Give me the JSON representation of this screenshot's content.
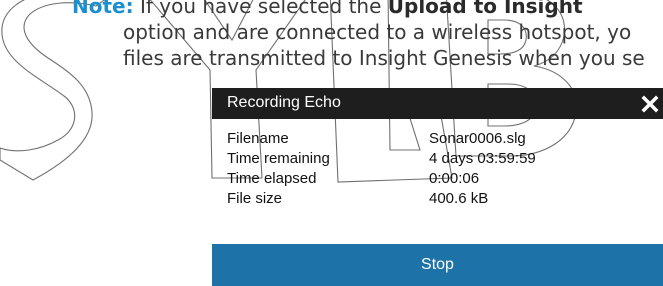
{
  "doc": {
    "note_label": "Note:",
    "line1_text": " If you have selected the ",
    "line1_bold": "Upload to Insight",
    "line2_text": "option and are connected to a wireless hotspot, yo",
    "line3_text": "files are transmitted to Insight Genesis when you se"
  },
  "dialog": {
    "title": "Recording Echo",
    "close_icon": "close-icon",
    "rows": [
      {
        "label": "Filename",
        "value": "Sonar0006.slg"
      },
      {
        "label": "Time remaining",
        "value": "4 days 03:59:59"
      },
      {
        "label": "Time elapsed",
        "value": "0:00:06"
      },
      {
        "label": "File size",
        "value": "400.6 kB"
      }
    ],
    "stop_label": "Stop"
  },
  "colors": {
    "note_accent": "#1b8fd0",
    "header_bg": "#1e1e1e",
    "stop_button_bg": "#1d73a8"
  }
}
